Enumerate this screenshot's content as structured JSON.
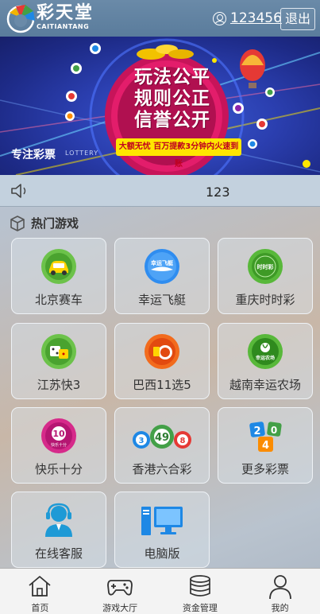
{
  "header": {
    "brand_cn": "彩天堂",
    "brand_en": "CAITIANTANG",
    "username": "123456",
    "logout_label": "退出"
  },
  "banner": {
    "line1": "玩法公平",
    "line2": "规则公正",
    "line3": "信誉公开",
    "sub": "大额无忧 百万提款3分钟内火速到账",
    "tag": "专注彩票",
    "tag_en": "LOTTERY"
  },
  "notice": {
    "text": "123"
  },
  "section": {
    "title": "热门游戏"
  },
  "games": [
    {
      "label": "北京赛车",
      "icon": "racecar-icon"
    },
    {
      "label": "幸运飞艇",
      "icon": "airship-icon",
      "badge": "幸运飞艇"
    },
    {
      "label": "重庆时时彩",
      "icon": "shishicai-icon",
      "badge": "时时彩"
    },
    {
      "label": "江苏快3",
      "icon": "dice-icon"
    },
    {
      "label": "巴西11选5",
      "icon": "eleven-five-icon"
    },
    {
      "label": "越南幸运农场",
      "icon": "farm-icon",
      "badge": "幸运农场"
    },
    {
      "label": "快乐十分",
      "icon": "happy-ten-icon",
      "badge": "快乐十分"
    },
    {
      "label": "香港六合彩",
      "icon": "lottery-balls-icon",
      "balls": [
        "3",
        "49",
        "8"
      ]
    },
    {
      "label": "更多彩票",
      "icon": "more-lottery-icon",
      "digits": [
        "2",
        "0",
        "4"
      ]
    },
    {
      "label": "在线客服",
      "icon": "customer-service-icon"
    },
    {
      "label": "电脑版",
      "icon": "desktop-computer-icon"
    }
  ],
  "nav": [
    {
      "label": "首页",
      "icon": "home-icon"
    },
    {
      "label": "游戏大厅",
      "icon": "gamepad-icon"
    },
    {
      "label": "资金管理",
      "icon": "coins-icon"
    },
    {
      "label": "我的",
      "icon": "user-icon"
    }
  ],
  "colors": {
    "header_bg": "#6a8aa8",
    "banner_bg": "#2b3fb0",
    "accent_red": "#d8185a",
    "yellow": "#ffe600"
  }
}
